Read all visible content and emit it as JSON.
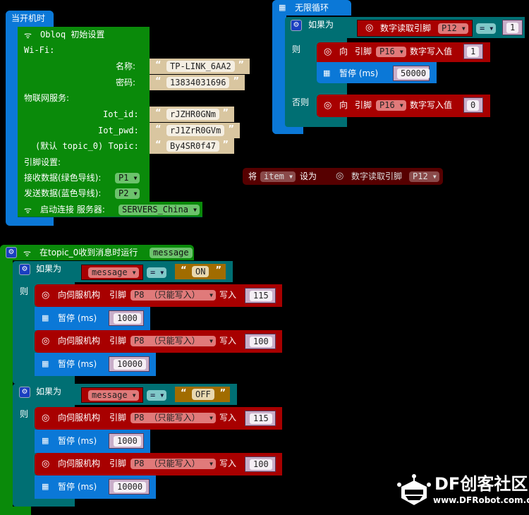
{
  "start_block": {
    "title": "当开机时",
    "obloq": {
      "title": "Obloq 初始设置",
      "wifi_label": "Wi-Fi:",
      "name_label": "名称:",
      "name_value": "TP-LINK_6AA2",
      "password_label": "密码:",
      "password_value": "13834031696",
      "iot_label": "物联网服务:",
      "iot_id_label": "Iot_id:",
      "iot_id_value": "rJZHR0GNm",
      "iot_pwd_label": "Iot_pwd:",
      "iot_pwd_value": "rJ1ZrR0GVm",
      "topic_label": "(默认 topic_0) Topic:",
      "topic_value": "By4SR0f47",
      "pin_label": "引脚设置:",
      "rx_label": "接收数据(绿色导线):",
      "rx_pin": "P1",
      "tx_label": "发送数据(蓝色导线):",
      "tx_pin": "P2"
    },
    "connect": {
      "label": "启动连接 服务器:",
      "server": "SERVERS_China"
    }
  },
  "loop_block": {
    "title": "无限循环",
    "if_label": "如果为",
    "then_label": "则",
    "else_label": "否则",
    "cond_read_label": "数字读取引脚",
    "cond_pin": "P12",
    "cond_op": "=",
    "cond_value": "1",
    "then_write_to": "向",
    "then_pin_label": "引脚",
    "then_pin": "P16",
    "then_write_label": "数字写入值",
    "then_write_value": "1",
    "pause_label": "暂停 (ms)",
    "pause_value": "50000",
    "else_write_to": "向",
    "else_pin_label": "引脚",
    "else_pin": "P16",
    "else_write_label": "数字写入值",
    "else_write_value": "0"
  },
  "set_block": {
    "set_label": "将",
    "variable": "item",
    "to_label": "设为",
    "read_label": "数字读取引脚",
    "pin": "P12"
  },
  "msg_block": {
    "title": "在topic_0收到消息时运行",
    "param": "message",
    "if1": {
      "if_label": "如果为",
      "then_label": "则",
      "var": "message",
      "op": "=",
      "value": "ON",
      "actions": [
        {
          "type": "servo",
          "label": "向伺服机构",
          "pin_label": "引脚",
          "pin": "P8 （只能写入）",
          "write_label": "写入",
          "value": "115"
        },
        {
          "type": "pause",
          "label": "暂停 (ms)",
          "value": "1000"
        },
        {
          "type": "servo",
          "label": "向伺服机构",
          "pin_label": "引脚",
          "pin": "P8 （只能写入）",
          "write_label": "写入",
          "value": "100"
        },
        {
          "type": "pause",
          "label": "暂停 (ms)",
          "value": "10000"
        }
      ]
    },
    "if2": {
      "if_label": "如果为",
      "then_label": "则",
      "var": "message",
      "op": "=",
      "value": "OFF",
      "actions": [
        {
          "type": "servo",
          "label": "向伺服机构",
          "pin_label": "引脚",
          "pin": "P8 （只能写入）",
          "write_label": "写入",
          "value": "115"
        },
        {
          "type": "pause",
          "label": "暂停 (ms)",
          "value": "1000"
        },
        {
          "type": "servo",
          "label": "向伺服机构",
          "pin_label": "引脚",
          "pin": "P8 （只能写入）",
          "write_label": "写入",
          "value": "100"
        },
        {
          "type": "pause",
          "label": "暂停 (ms)",
          "value": "10000"
        }
      ]
    }
  },
  "watermark": {
    "brand": "DF创客社区",
    "url": "www.DFRobot.com.cn"
  }
}
